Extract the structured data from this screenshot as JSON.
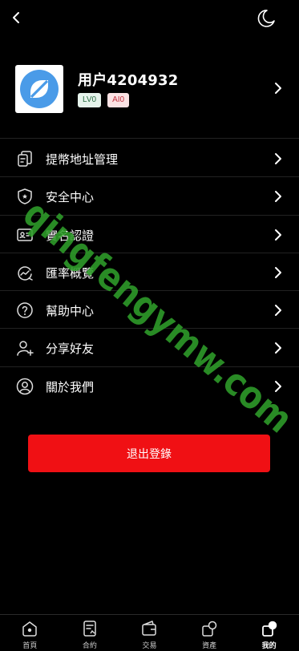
{
  "profile": {
    "username": "用户4204932",
    "level_badge": "LV0",
    "ai_badge": "AI0"
  },
  "menu": [
    {
      "label": "提幣地址管理",
      "icon": "address-book-icon"
    },
    {
      "label": "安全中心",
      "icon": "shield-icon"
    },
    {
      "label": "實名認證",
      "icon": "id-card-icon"
    },
    {
      "label": "匯率概覽",
      "icon": "exchange-rate-icon"
    },
    {
      "label": "幫助中心",
      "icon": "help-icon"
    },
    {
      "label": "分享好友",
      "icon": "add-user-icon"
    },
    {
      "label": "關於我們",
      "icon": "about-icon"
    }
  ],
  "logout_label": "退出登錄",
  "watermark": "qingfengymw.com",
  "tabs": [
    {
      "label": "首頁",
      "icon": "home-icon",
      "active": false
    },
    {
      "label": "合約",
      "icon": "contract-icon",
      "active": false
    },
    {
      "label": "交易",
      "icon": "wallet-icon",
      "active": false
    },
    {
      "label": "資產",
      "icon": "assets-icon",
      "active": false
    },
    {
      "label": "我的",
      "icon": "profile-icon",
      "active": true
    }
  ],
  "colors": {
    "background": "#000000",
    "logout_button": "#f01014",
    "avatar_logo": "#4a9be8",
    "watermark": "#2f9e2a"
  }
}
